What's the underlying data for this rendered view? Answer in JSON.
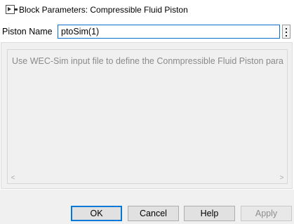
{
  "window": {
    "title": "Block Parameters: Compressible Fluid Piston",
    "icon": "simulink-block-icon"
  },
  "parameter": {
    "label": "Piston Name",
    "value": "ptoSim(1)"
  },
  "description": {
    "text": "Use WEC-Sim input file to define the Conmpressible Fluid Piston para"
  },
  "buttons": {
    "ok": "OK",
    "cancel": "Cancel",
    "help": "Help",
    "apply": "Apply"
  },
  "scroll": {
    "left_arrow": "<",
    "right_arrow": ">"
  },
  "colors": {
    "focus_border": "#0078d7",
    "description_text": "#8a8a8a",
    "disabled_text": "#8d8d8d"
  }
}
